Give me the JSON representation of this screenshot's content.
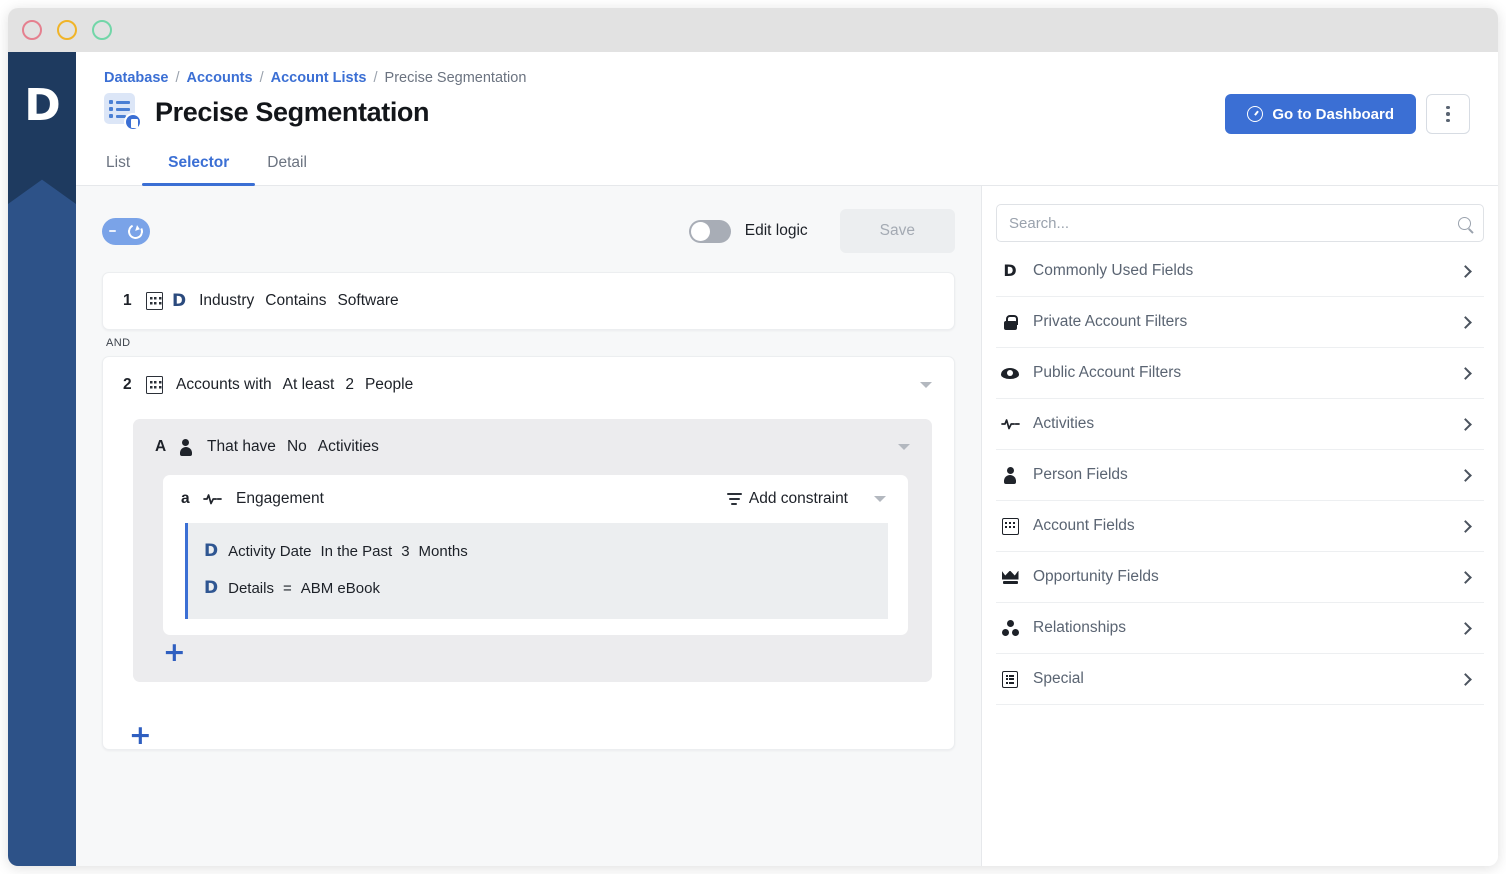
{
  "window": {
    "traffic_lights": [
      {
        "name": "close",
        "color": "#e5808f"
      },
      {
        "name": "minimize",
        "color": "#f0b429"
      },
      {
        "name": "maximize",
        "color": "#72d6a8"
      }
    ]
  },
  "rail": {
    "logo_letter": "D",
    "bg": "#2d5288",
    "logo_bg": "#1e3a5f"
  },
  "header": {
    "breadcrumb": [
      {
        "label": "Database",
        "link": true
      },
      {
        "label": "Accounts",
        "link": true
      },
      {
        "label": "Account Lists",
        "link": true
      },
      {
        "label": "Precise Segmentation",
        "link": false
      }
    ],
    "separator": "/",
    "title": "Precise Segmentation",
    "title_icon": "list-document-icon",
    "dashboard_button": "Go to Dashboard",
    "dashboard_icon": "clock-icon",
    "kebab_icon": "more-options-icon",
    "accent": "#3b6fd4"
  },
  "tabs": [
    {
      "label": "List",
      "active": false
    },
    {
      "label": "Selector",
      "active": true
    },
    {
      "label": "Detail",
      "active": false
    }
  ],
  "builder": {
    "refresh_button": "refresh-toggle",
    "edit_logic_label": "Edit logic",
    "edit_logic_on": false,
    "save_label": "Save",
    "save_disabled": true,
    "and_connector": "AND",
    "add_rule_label": "+",
    "rules": [
      {
        "index": "1",
        "icons": [
          "building-icon",
          "d-logo-icon"
        ],
        "tokens": [
          "Industry",
          "Contains",
          "Software"
        ],
        "has_caret": false
      },
      {
        "index": "2",
        "icons": [
          "building-icon"
        ],
        "tokens": [
          "Accounts with",
          "At least",
          "2",
          "People"
        ],
        "has_caret": true,
        "sub": {
          "index": "A",
          "icons": [
            "person-icon"
          ],
          "tokens": [
            "That have",
            "No",
            "Activities"
          ],
          "has_caret": true,
          "sub": {
            "index": "a",
            "icons": [
              "pulse-icon"
            ],
            "tokens": [
              "Engagement"
            ],
            "add_constraint_label": "Add constraint",
            "add_constraint_icon": "filter-icon",
            "has_caret": true,
            "constraints": [
              {
                "icon": "d-logo-icon",
                "tokens": [
                  "Activity Date",
                  "In the Past",
                  "3",
                  "Months"
                ]
              },
              {
                "icon": "d-logo-icon",
                "tokens": [
                  "Details",
                  "=",
                  "ABM eBook"
                ]
              }
            ]
          },
          "add_label": "+"
        }
      }
    ]
  },
  "library": {
    "search_placeholder": "Search...",
    "search_value": "",
    "search_icon": "search-icon",
    "chevron_icon": "chevron-right-icon",
    "items": [
      {
        "label": "Commonly Used Fields",
        "icon": "d-logo-icon"
      },
      {
        "label": "Private Account Filters",
        "icon": "lock-icon"
      },
      {
        "label": "Public Account Filters",
        "icon": "eye-icon"
      },
      {
        "label": "Activities",
        "icon": "pulse-icon"
      },
      {
        "label": "Person Fields",
        "icon": "person-icon"
      },
      {
        "label": "Account Fields",
        "icon": "building-icon"
      },
      {
        "label": "Opportunity Fields",
        "icon": "crown-icon"
      },
      {
        "label": "Relationships",
        "icon": "relationships-icon"
      },
      {
        "label": "Special",
        "icon": "list-icon"
      }
    ]
  }
}
